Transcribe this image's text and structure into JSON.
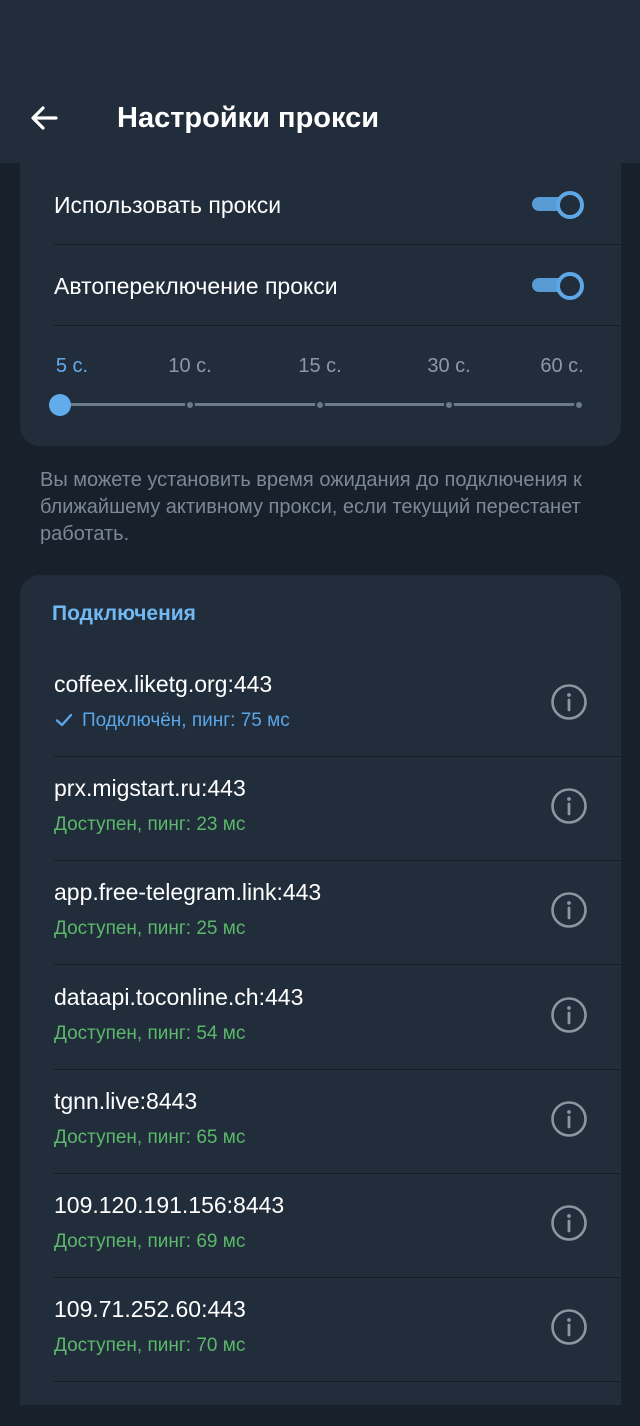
{
  "header": {
    "title": "Настройки прокси",
    "back_icon": "arrow-left-icon"
  },
  "settings": {
    "use_proxy": {
      "label": "Использовать прокси",
      "enabled": true
    },
    "auto_switch": {
      "label": "Автопереключение прокси",
      "enabled": true
    },
    "timeout_options": [
      "5 с.",
      "10 с.",
      "15 с.",
      "30 с.",
      "60 с."
    ],
    "timeout_selected": "5 с."
  },
  "hint": "Вы можете установить время ожидания до подключения к ближайшему активному прокси, если текущий перестанет работать.",
  "connections": {
    "title": "Подключения",
    "items": [
      {
        "host": "coffeex.liketg.org:443",
        "status": "Подключён, пинг: 75 мс",
        "connected": true
      },
      {
        "host": "prx.migstart.ru:443",
        "status": "Доступен, пинг: 23 мс",
        "connected": false
      },
      {
        "host": "app.free-telegram.link:443",
        "status": "Доступен, пинг: 25 мс",
        "connected": false
      },
      {
        "host": "dataapi.toconline.ch:443",
        "status": "Доступен, пинг: 54 мс",
        "connected": false
      },
      {
        "host": "tgnn.live:8443",
        "status": "Доступен, пинг: 65 мс",
        "connected": false
      },
      {
        "host": "109.120.191.156:8443",
        "status": "Доступен, пинг: 69 мс",
        "connected": false
      },
      {
        "host": "109.71.252.60:443",
        "status": "Доступен, пинг: 70 мс",
        "connected": false
      }
    ]
  },
  "colors": {
    "accent": "#62acec",
    "available": "#5cb86a",
    "background": "#18202b",
    "card": "#212d3b"
  }
}
